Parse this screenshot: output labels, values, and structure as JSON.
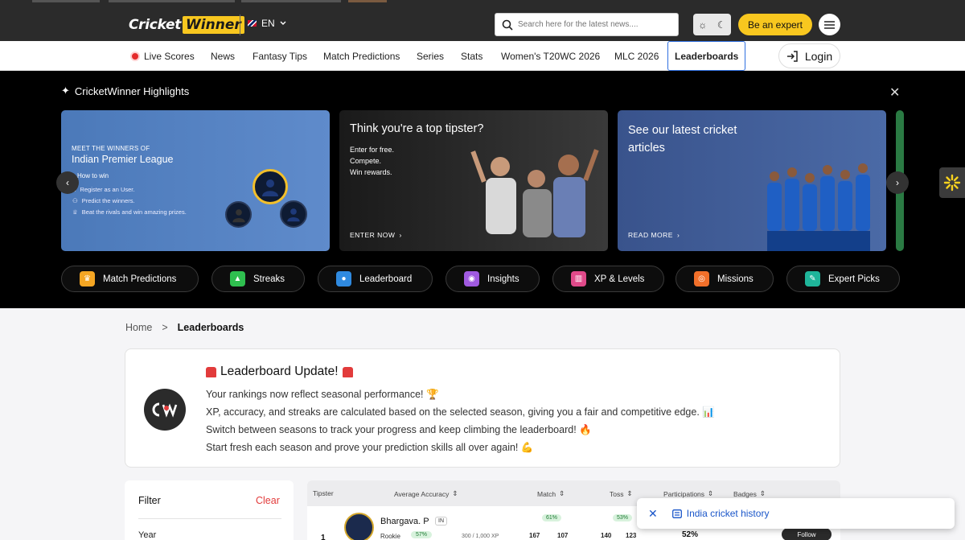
{
  "header": {
    "logo_part1": "Cricket",
    "logo_part2": "Winner",
    "language": "EN",
    "search_placeholder": "Search here for the latest news....",
    "expert_button": "Be an expert"
  },
  "nav": {
    "items": [
      "Live Scores",
      "News",
      "Fantasy Tips",
      "Match Predictions",
      "Series",
      "Stats",
      "Women's T20WC 2026",
      "MLC 2026",
      "Leaderboards"
    ],
    "active": "Leaderboards",
    "login": "Login"
  },
  "highlights": {
    "title": "CricketWinner Highlights",
    "card1": {
      "small": "MEET THE WINNERS OF",
      "big": "Indian Premier League",
      "how": "How to win",
      "steps": [
        "Register as an User.",
        "Predict the winners.",
        "Beat the rivals and win amazing prizes."
      ]
    },
    "card2": {
      "title": "Think you're a top tipster?",
      "lines": [
        "Enter for free.",
        "Compete.",
        "Win rewards."
      ],
      "cta": "ENTER NOW"
    },
    "card3": {
      "title": "See our latest cricket articles",
      "cta": "READ MORE"
    },
    "pills": [
      {
        "label": "Match Predictions",
        "color": "#f5a623",
        "icon": "trophy-icon"
      },
      {
        "label": "Streaks",
        "color": "#2fbf4f",
        "icon": "fire-icon"
      },
      {
        "label": "Leaderboard",
        "color": "#2f8ae0",
        "icon": "medal-icon"
      },
      {
        "label": "Insights",
        "color": "#a05ae0",
        "icon": "bulb-icon"
      },
      {
        "label": "XP & Levels",
        "color": "#e04a8a",
        "icon": "chart-icon"
      },
      {
        "label": "Missions",
        "color": "#f2702a",
        "icon": "target-icon"
      },
      {
        "label": "Expert Picks",
        "color": "#1fb59a",
        "icon": "pencil-icon"
      }
    ]
  },
  "breadcrumb": {
    "home": "Home",
    "sep": ">",
    "current": "Leaderboards"
  },
  "update": {
    "title": "Leaderboard Update!",
    "lines": [
      "Your rankings now reflect seasonal performance! 🏆",
      "XP, accuracy, and streaks are calculated based on the selected season, giving you a fair and competitive edge. 📊",
      "Switch between seasons to track your progress and keep climbing the leaderboard! 🔥",
      "Start fresh each season and prove your prediction skills all over again! 💪"
    ]
  },
  "filter": {
    "title": "Filter",
    "clear": "Clear",
    "year": "Year"
  },
  "table": {
    "headers": [
      "Tipster",
      "Average Accuracy",
      "Match",
      "Toss",
      "Participations",
      "Badges"
    ],
    "row": {
      "rank": "1",
      "name": "Bhargava. P",
      "country": "IN",
      "level": "Rookie",
      "accuracy": "57%",
      "xp": "300 / 1,000 XP",
      "match_pct": "61%",
      "match_up": "167",
      "match_down": "107",
      "toss_pct": "53%",
      "toss_up": "140",
      "toss_down": "123",
      "participation": "52%",
      "follow": "Follow"
    }
  },
  "toast": {
    "label": "India cricket history"
  }
}
